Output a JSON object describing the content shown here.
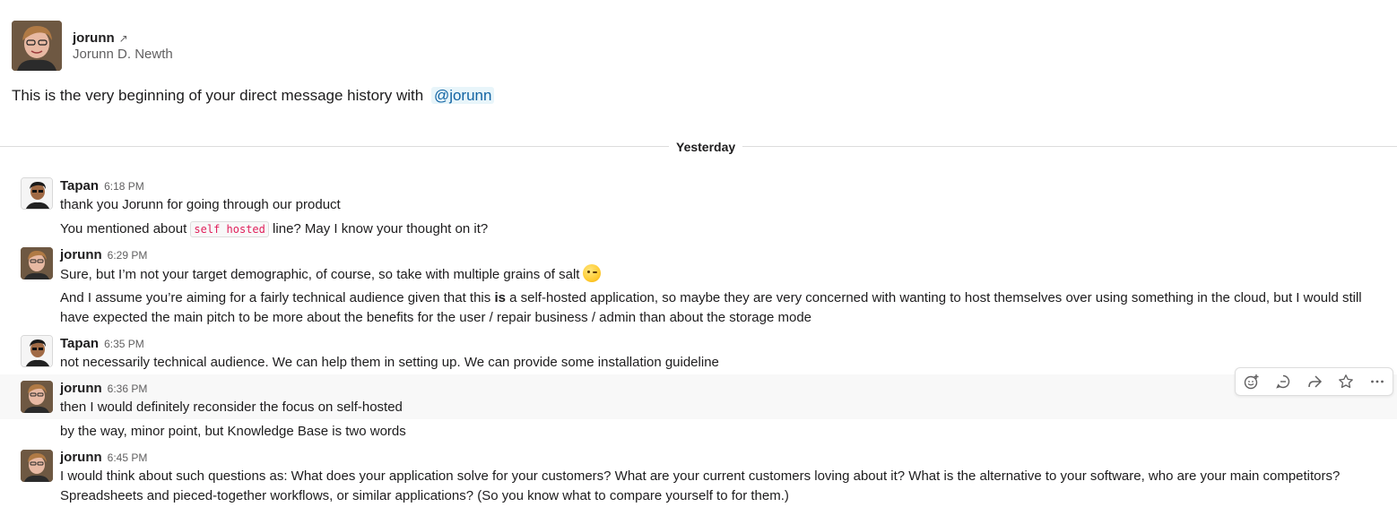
{
  "profile": {
    "handle": "jorunn",
    "full_name": "Jorunn D. Newth"
  },
  "intro": {
    "text": "This is the very beginning of your direct message history with ",
    "mention": "@jorunn"
  },
  "divider": {
    "label": "Yesterday"
  },
  "messages": [
    {
      "sender": "Tapan",
      "time": "6:18 PM",
      "line1": "thank you Jorunn for going through our product",
      "line2_before": "You mentioned about ",
      "line2_code": "self hosted",
      "line2_after": " line? May I know your thought on it?"
    },
    {
      "sender": "jorunn",
      "time": "6:29 PM",
      "line1": "Sure, but I’m not your target demographic, of course, so take with multiple grains of salt",
      "emoji": "winking-face",
      "line2_before": "And I assume you’re aiming for a fairly technical audience given that this ",
      "line2_bold": "is",
      "line2_after": " a self-hosted application, so maybe they are very concerned with wanting to host themselves over using something in the cloud, but I would still have expected the main pitch to be more about the benefits for the user / repair business / admin than about the storage mode"
    },
    {
      "sender": "Tapan",
      "time": "6:35 PM",
      "line1": "not necessarily technical audience. We can help them in setting up. We can provide some installation guideline"
    },
    {
      "sender": "jorunn",
      "time": "6:36 PM",
      "line1": "then I would definitely reconsider the focus on self-hosted",
      "line2": "by the way, minor point, but Knowledge Base is two words"
    },
    {
      "sender": "jorunn",
      "time": "6:45 PM",
      "line1": "I would think about such questions as: What does your application solve for your customers? What are your current customers loving about it? What is the alternative to your software, who are your main competitors? Spreadsheets and pieced-together workflows, or similar applications? (So you know what to compare yourself to for them.)"
    }
  ],
  "actions": [
    "add-reaction-icon",
    "reply-thread-icon",
    "share-icon",
    "star-icon",
    "more-icon"
  ]
}
